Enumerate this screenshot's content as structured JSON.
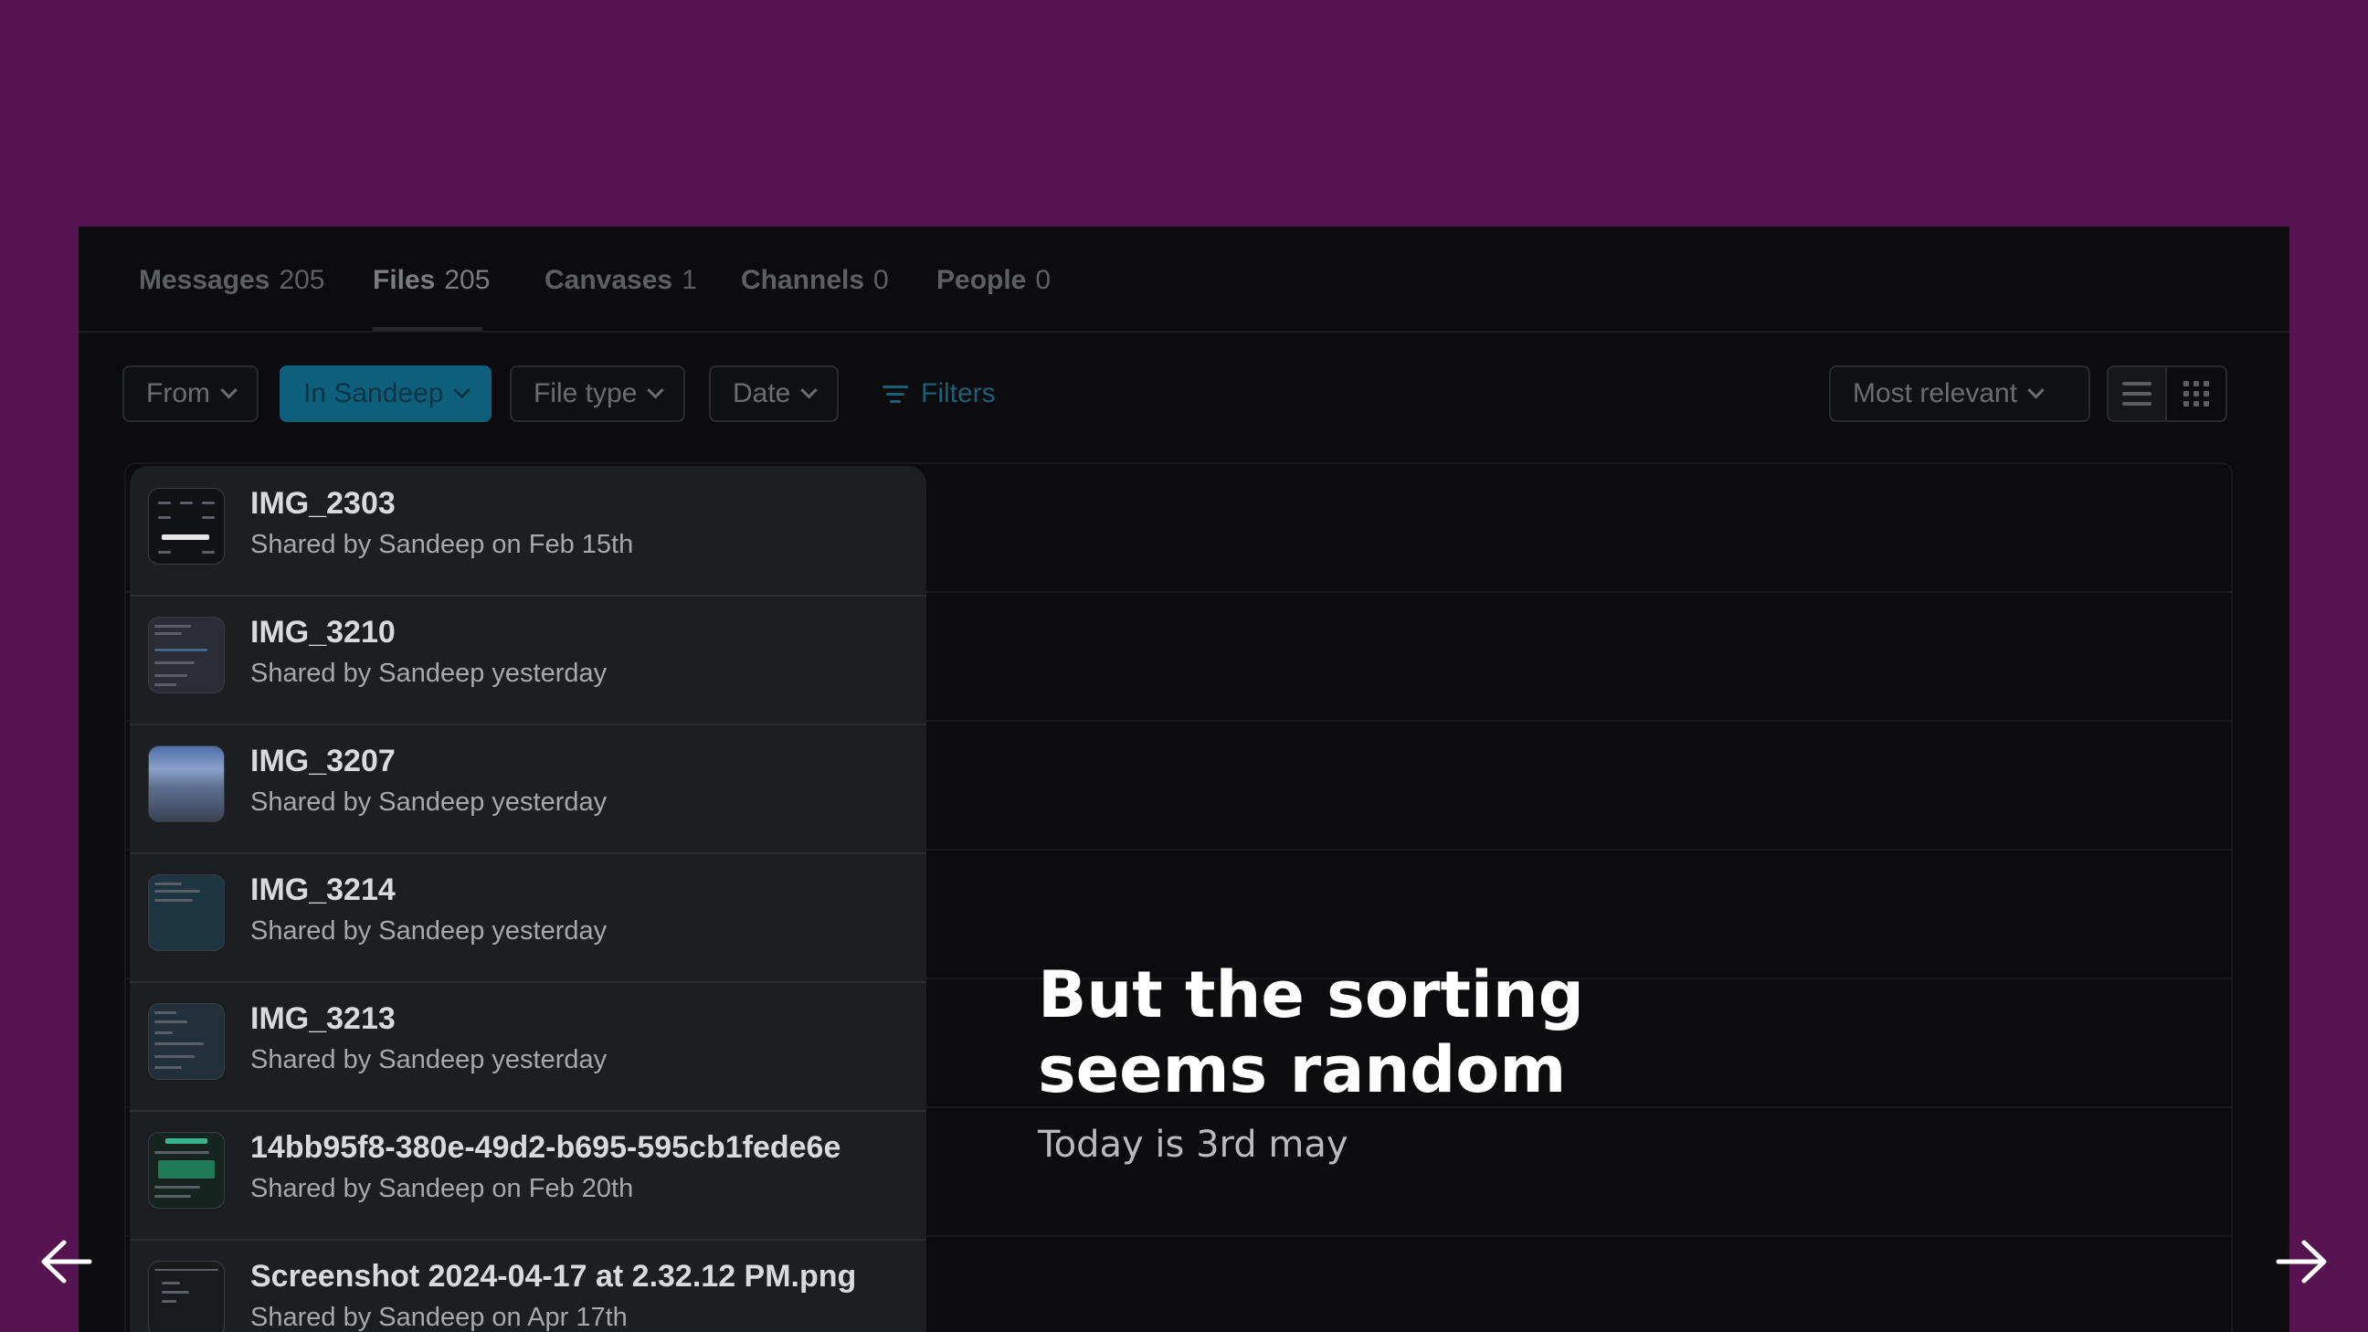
{
  "tabs": [
    {
      "label": "Messages",
      "count": "205"
    },
    {
      "label": "Files",
      "count": "205"
    },
    {
      "label": "Canvases",
      "count": "1"
    },
    {
      "label": "Channels",
      "count": "0"
    },
    {
      "label": "People",
      "count": "0"
    }
  ],
  "active_tab": "Files",
  "filters": {
    "from": "From",
    "in": "In Sandeep",
    "file_type": "File type",
    "date": "Date",
    "filters_link": "Filters",
    "sort": "Most relevant"
  },
  "files": [
    {
      "name": "IMG_2303",
      "meta": "Shared by Sandeep on Feb 15th"
    },
    {
      "name": "IMG_3210",
      "meta": "Shared by Sandeep yesterday"
    },
    {
      "name": "IMG_3207",
      "meta": "Shared by Sandeep yesterday"
    },
    {
      "name": "IMG_3214",
      "meta": "Shared by Sandeep yesterday"
    },
    {
      "name": "IMG_3213",
      "meta": "Shared by Sandeep yesterday"
    },
    {
      "name": "14bb95f8-380e-49d2-b695-595cb1fede6e",
      "meta": "Shared by Sandeep on Feb 20th"
    },
    {
      "name": "Screenshot 2024-04-17 at 2.32.12 PM.png",
      "meta": "Shared by Sandeep on Apr 17th"
    }
  ],
  "overlay": {
    "headline_line1": "But the sorting",
    "headline_line2": "seems random",
    "subline": "Today is 3rd may"
  },
  "icons": {
    "prev": "arrow-left-icon",
    "next": "arrow-right-icon",
    "list_view": "list-view-icon",
    "grid_view": "grid-view-icon",
    "filter": "filter-icon"
  },
  "colors": {
    "background": "#561350",
    "panel": "#0c0c0e",
    "accent": "#0d5f7c"
  }
}
